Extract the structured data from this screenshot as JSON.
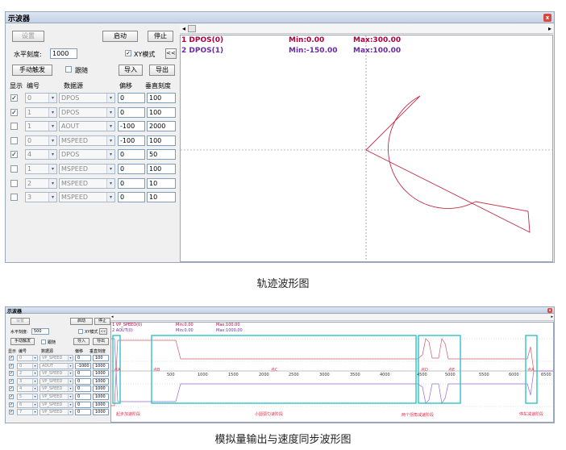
{
  "top": {
    "title": "示波器",
    "close": "x",
    "settings_label": "设置",
    "start_label": "启动",
    "stop_label": "停止",
    "h_scale_label": "水平刻度:",
    "h_scale_value": "1000",
    "xy_mode_label": "XY模式",
    "collapse_label": "<<",
    "manual_trigger_label": "手动触发",
    "follow_label": "跟随",
    "import_label": "导入",
    "export_label": "导出",
    "col_show": "显示",
    "col_num": "编号",
    "col_source": "数据源",
    "col_offset": "偏移",
    "col_vscale": "垂直刻度",
    "rows": [
      {
        "checked": true,
        "num": "0",
        "source": "DPOS",
        "offset": "0",
        "vscale": "100"
      },
      {
        "checked": true,
        "num": "1",
        "source": "DPOS",
        "offset": "0",
        "vscale": "100"
      },
      {
        "checked": false,
        "num": "1",
        "source": "AOUT",
        "offset": "-100",
        "vscale": "2000"
      },
      {
        "checked": false,
        "num": "0",
        "source": "MSPEED",
        "offset": "-100",
        "vscale": "100"
      },
      {
        "checked": true,
        "num": "4",
        "source": "DPOS",
        "offset": "0",
        "vscale": "50"
      },
      {
        "checked": false,
        "num": "1",
        "source": "MSPEED",
        "offset": "0",
        "vscale": "100"
      },
      {
        "checked": false,
        "num": "2",
        "source": "MSPEED",
        "offset": "0",
        "vscale": "10"
      },
      {
        "checked": false,
        "num": "3",
        "source": "MSPEED",
        "offset": "0",
        "vscale": "10"
      }
    ],
    "legend": [
      {
        "name": "1 DPOS(0)",
        "min": "Min:0.00",
        "max": "Max:300.00",
        "color": "#b0003a"
      },
      {
        "name": "2 DPOS(1)",
        "min": "Min:-150.00",
        "max": "Max:100.00",
        "color": "#6a2aa8"
      }
    ],
    "caption": "轨迹波形图"
  },
  "bottom": {
    "title": "示波器",
    "close": "x",
    "settings_label": "设置",
    "start_label": "启动",
    "stop_label": "停止",
    "h_scale_label": "水平刻度:",
    "h_scale_value": "500",
    "xy_mode_label": "XY模式",
    "collapse_label": "<<",
    "manual_trigger_label": "手动触发",
    "follow_label": "跟随",
    "import_label": "导入",
    "export_label": "导出",
    "col_show": "显示",
    "col_num": "编号",
    "col_source": "数据源",
    "col_offset": "偏移",
    "col_vscale": "垂直刻度",
    "rows": [
      {
        "checked": true,
        "num": "0",
        "source": "VP_SPEED",
        "offset": "0",
        "vscale": "100"
      },
      {
        "checked": true,
        "num": "0",
        "source": "AOUT",
        "offset": "-1000",
        "vscale": "1000"
      },
      {
        "checked": true,
        "num": "2",
        "source": "VP_SPEED",
        "offset": "0",
        "vscale": "1000"
      },
      {
        "checked": true,
        "num": "3",
        "source": "VP_SPEED",
        "offset": "0",
        "vscale": "1000"
      },
      {
        "checked": true,
        "num": "4",
        "source": "VP_SPEED",
        "offset": "0",
        "vscale": "1000"
      },
      {
        "checked": true,
        "num": "5",
        "source": "VP_SPEED",
        "offset": "0",
        "vscale": "1000"
      },
      {
        "checked": true,
        "num": "6",
        "source": "VP_SPEED",
        "offset": "0",
        "vscale": "1000"
      },
      {
        "checked": true,
        "num": "7",
        "source": "VP_SPEED",
        "offset": "0",
        "vscale": "1000"
      }
    ],
    "legend": [
      {
        "name": "1 VP_SPEED(0)",
        "min": "Min:0.00",
        "max": "Max:100.00",
        "color": "#b0003a"
      },
      {
        "name": "2 AOUT(0)",
        "min": "Min:0.00",
        "max": "Max:1000.00",
        "color": "#6a2aa8"
      }
    ],
    "x_ticks": [
      "500",
      "1000",
      "1500",
      "2000",
      "2500",
      "3000",
      "3500",
      "4000",
      "4500",
      "5000",
      "5500",
      "6000",
      "6500"
    ],
    "point_labels": [
      "点A",
      "点B",
      "点C",
      "点D",
      "点E",
      "点A"
    ],
    "regions": [
      "起步加速阶段",
      "小圆弧匀速阶段",
      "两个拐角减速阶段",
      "停车减速阶段"
    ],
    "caption": "模拟量输出与速度同步波形图"
  }
}
